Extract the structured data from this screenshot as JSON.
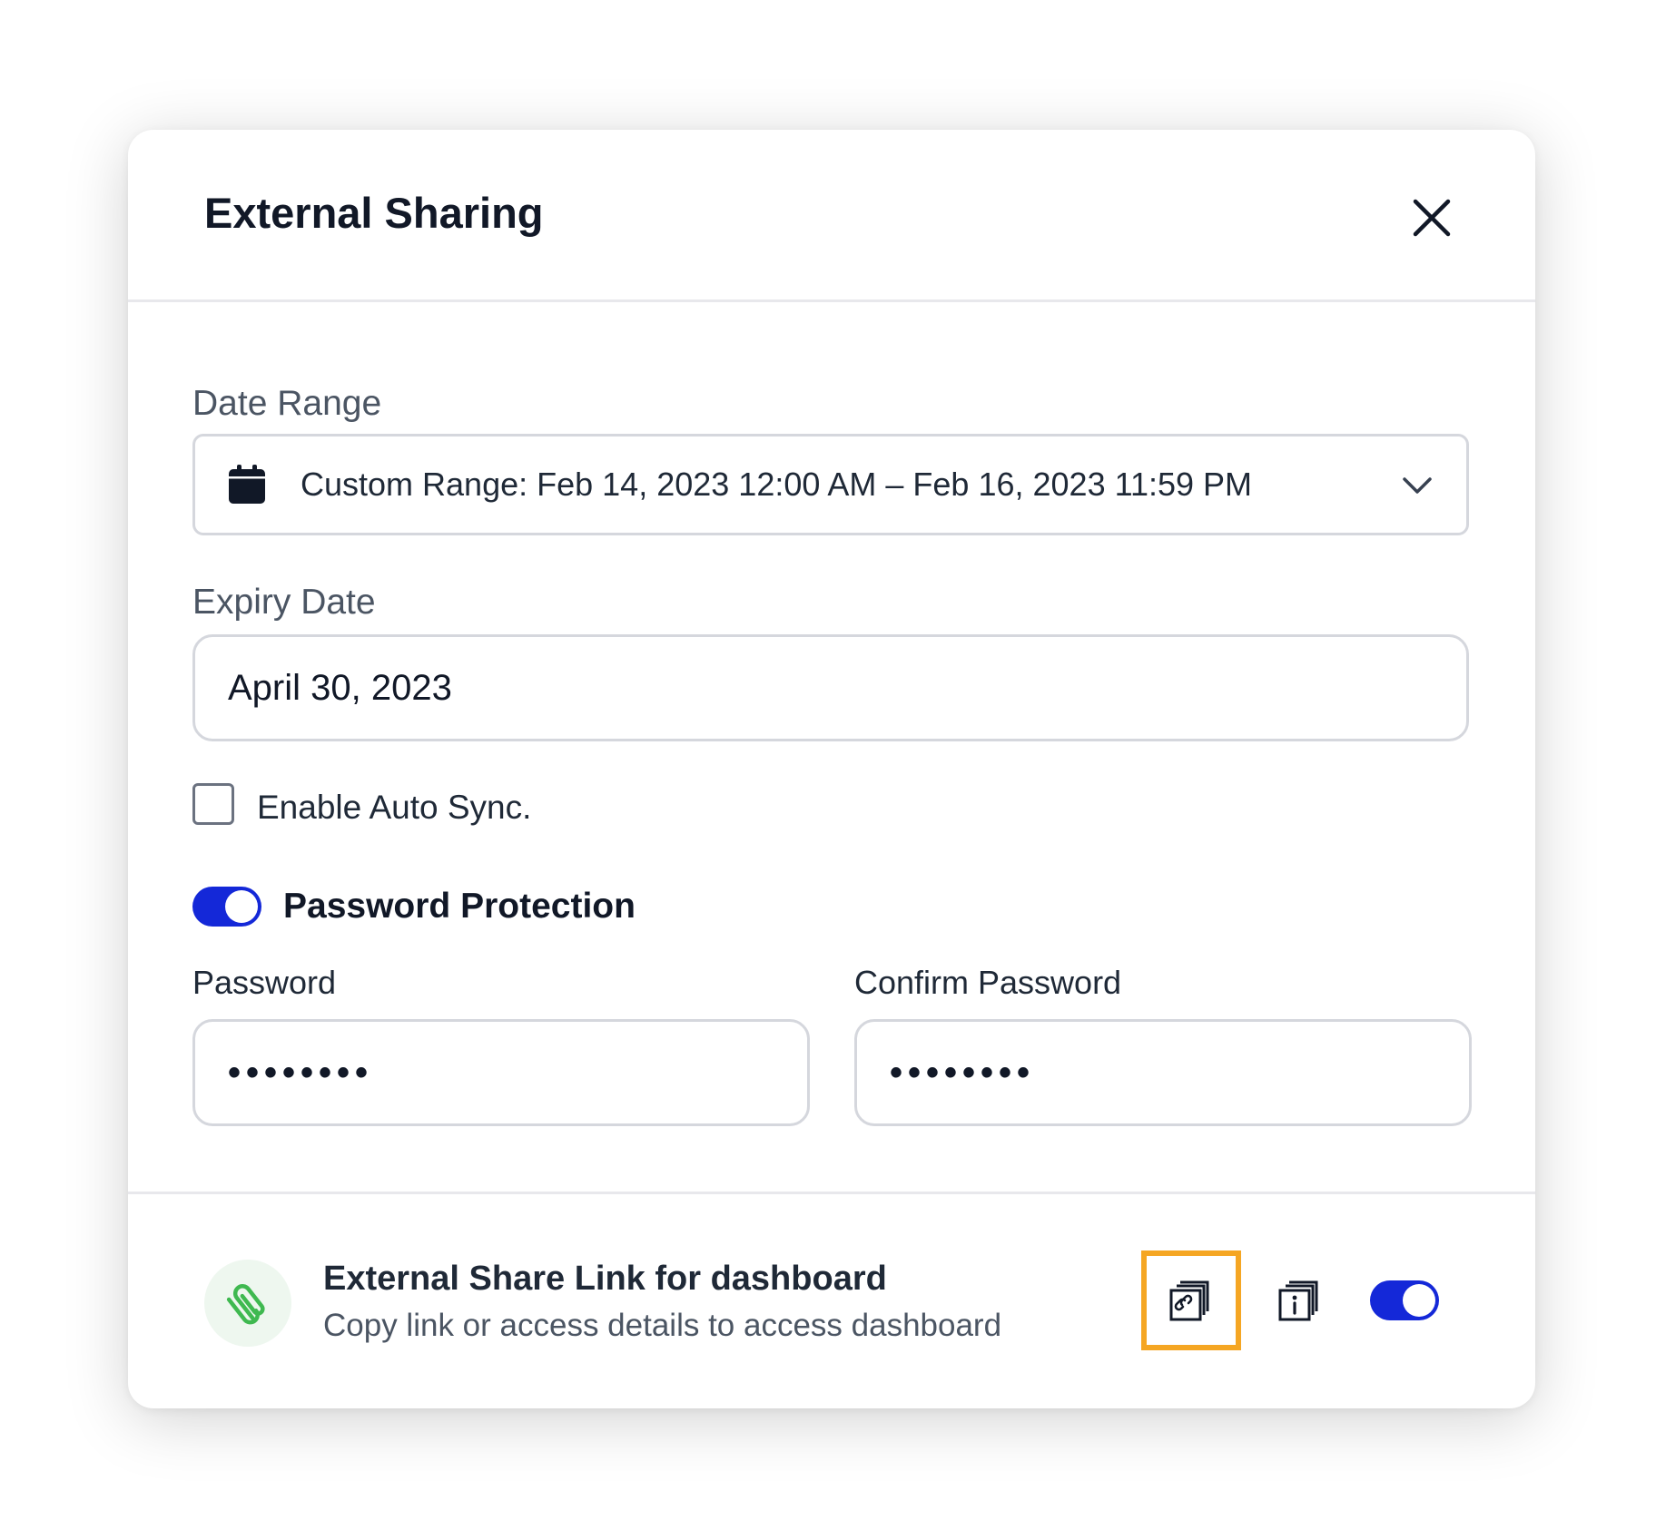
{
  "dialog": {
    "title": "External Sharing",
    "close_icon": "close-icon"
  },
  "date_range": {
    "label": "Date Range",
    "icon": "calendar-icon",
    "value": "Custom Range: Feb 14, 2023 12:00 AM – Feb 16, 2023 11:59 PM",
    "dropdown_icon": "chevron-down-icon"
  },
  "expiry": {
    "label": "Expiry Date",
    "value": "April 30, 2023"
  },
  "auto_sync": {
    "label": "Enable Auto Sync.",
    "checked": false
  },
  "password_protection": {
    "label": "Password Protection",
    "enabled": true,
    "accent_color": "#1428d8"
  },
  "password": {
    "label": "Password",
    "masked_value": "••••••••"
  },
  "confirm_password": {
    "label": "Confirm Password",
    "masked_value": "••••••••"
  },
  "share_link": {
    "icon": "paperclip-icon",
    "icon_color": "#3fb950",
    "title": "External Share Link for dashboard",
    "subtitle": "Copy link or access details to access dashboard",
    "copy_link_icon": "copy-link-icon",
    "copy_details_icon": "copy-info-icon",
    "enabled": true,
    "highlight_color": "#f5a623"
  }
}
